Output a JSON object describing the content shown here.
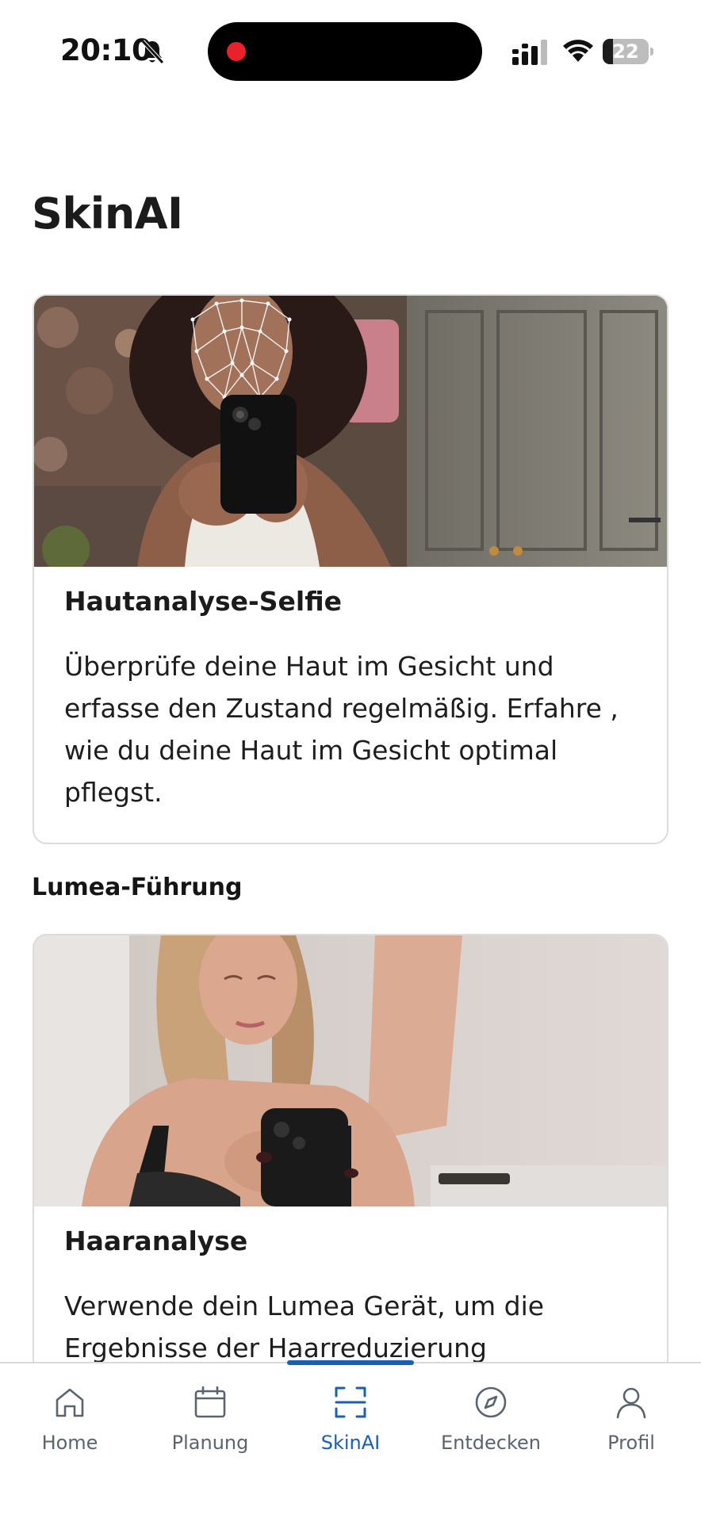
{
  "status_bar": {
    "time": "20:10",
    "battery_level": "22"
  },
  "page": {
    "title": "SkinAI"
  },
  "cards": [
    {
      "title": "Hautanalyse-Selfie",
      "description": "Überprüfe deine Haut im Gesicht und erfasse den Zustand regelmäßig. Erfahre , wie du deine Haut im Gesicht optimal pflegst."
    },
    {
      "title": "Haaranalyse",
      "description": "Verwende dein Lumea Gerät, um die Ergebnisse der Haarreduzierung"
    }
  ],
  "section": {
    "label": "Lumea-Führung"
  },
  "nav": {
    "items": [
      {
        "label": "Home",
        "icon": "home-icon"
      },
      {
        "label": "Planung",
        "icon": "calendar-icon"
      },
      {
        "label": "SkinAI",
        "icon": "scan-icon",
        "active": true
      },
      {
        "label": "Entdecken",
        "icon": "compass-icon"
      },
      {
        "label": "Profil",
        "icon": "profile-icon"
      }
    ]
  },
  "colors": {
    "accent": "#1a5fb4",
    "text": "#1b1b1b",
    "nav_inactive": "#5a6470",
    "card_border": "#dcdcdc"
  }
}
